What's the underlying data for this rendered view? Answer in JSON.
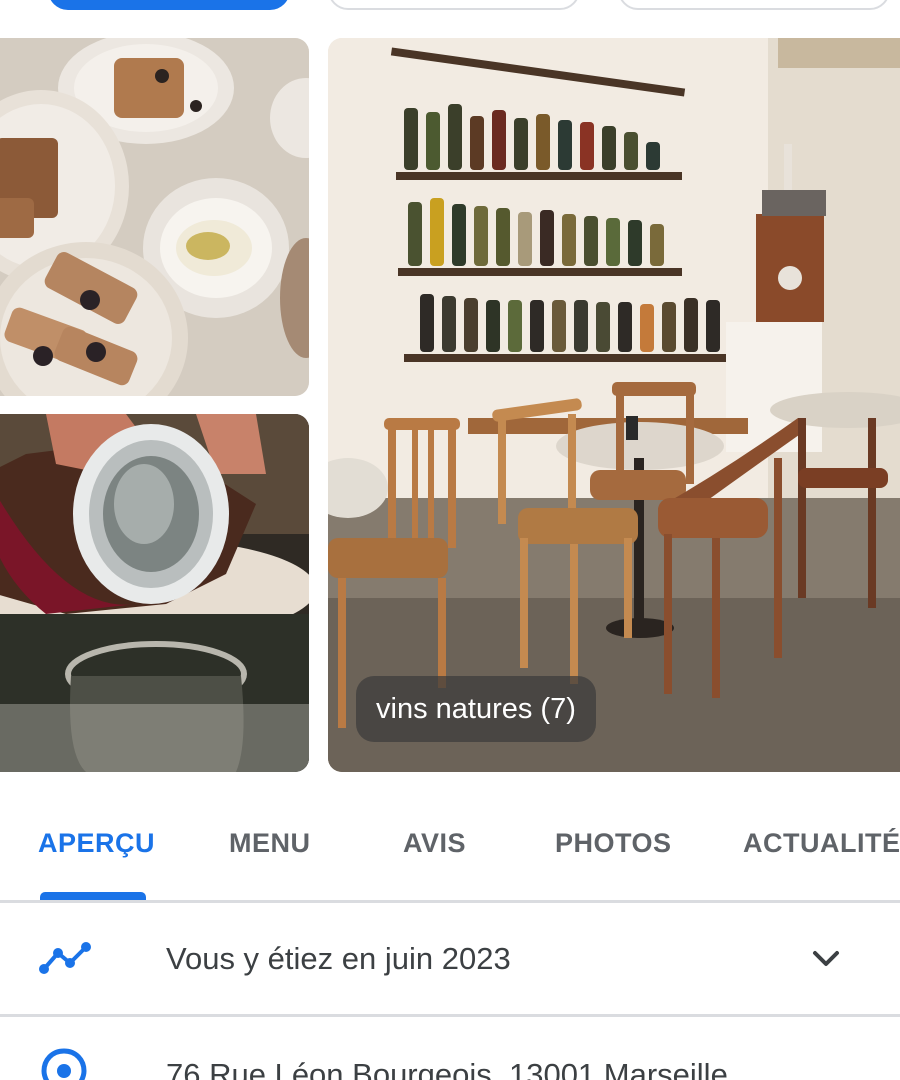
{
  "photos": {
    "caption": "vins natures (7)"
  },
  "tabs": [
    {
      "label": "APERÇU",
      "active": true
    },
    {
      "label": "MENU",
      "active": false
    },
    {
      "label": "AVIS",
      "active": false
    },
    {
      "label": "PHOTOS",
      "active": false
    },
    {
      "label": "ACTUALITÉ",
      "active": false
    }
  ],
  "visit": {
    "text": "Vous y étiez en juin 2023",
    "icon": "timeline-icon",
    "expand_icon": "chevron-down-icon"
  },
  "address": {
    "text": "76 Rue Léon Bourgeois, 13001 Marseille",
    "icon": "location-pin-icon"
  },
  "colors": {
    "accent": "#1a73e8",
    "text": "#3c4043",
    "tab_inactive": "#5f6368",
    "divider": "#dadce0"
  }
}
